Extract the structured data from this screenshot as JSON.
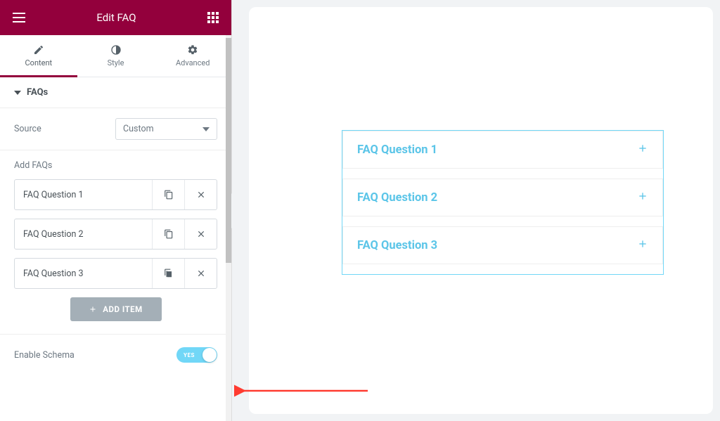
{
  "header": {
    "title": "Edit FAQ"
  },
  "tabs": {
    "content": "Content",
    "style": "Style",
    "advanced": "Advanced"
  },
  "sections": {
    "faqs": {
      "title": "FAQs",
      "source_label": "Source",
      "source_value": "Custom",
      "add_label": "Add FAQs",
      "items": [
        {
          "title": "FAQ Question 1"
        },
        {
          "title": "FAQ Question 2"
        },
        {
          "title": "FAQ Question 3"
        }
      ],
      "add_item_label": "ADD ITEM",
      "schema_label": "Enable Schema",
      "schema_toggle": "YES"
    }
  },
  "preview": {
    "questions": [
      {
        "title": "FAQ Question 1"
      },
      {
        "title": "FAQ Question 2"
      },
      {
        "title": "FAQ Question 3"
      }
    ]
  }
}
